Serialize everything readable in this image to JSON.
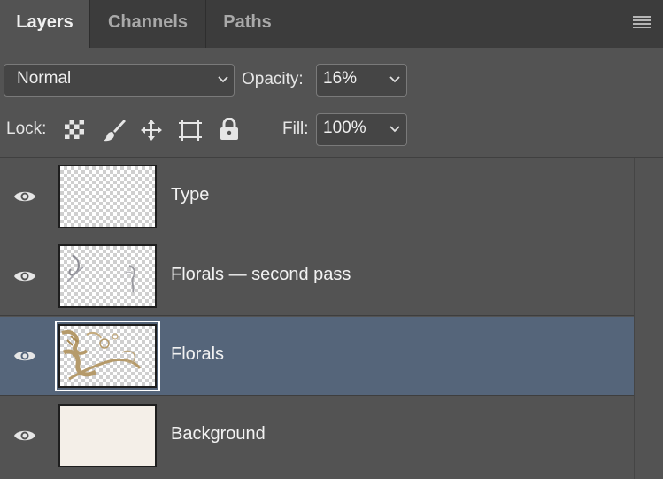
{
  "tabs": [
    {
      "label": "Layers",
      "active": true
    },
    {
      "label": "Channels",
      "active": false
    },
    {
      "label": "Paths",
      "active": false
    }
  ],
  "blend_mode": {
    "value": "Normal"
  },
  "opacity": {
    "label": "Opacity:",
    "value": "16%"
  },
  "lock": {
    "label": "Lock:",
    "icons": [
      "lock-transparent-pixels-icon",
      "lock-image-pixels-icon",
      "lock-position-icon",
      "lock-artboard-icon",
      "lock-all-icon"
    ]
  },
  "fill": {
    "label": "Fill:",
    "value": "100%"
  },
  "layers": [
    {
      "name": "Type",
      "visible": true,
      "selected": false
    },
    {
      "name": "Florals — second pass",
      "visible": true,
      "selected": false
    },
    {
      "name": "Florals",
      "visible": true,
      "selected": true
    },
    {
      "name": "Background",
      "visible": true,
      "selected": false
    }
  ],
  "colors": {
    "panel_bg": "#535353",
    "tabbar_bg": "#3c3c3c",
    "selected_row": "#55657a",
    "background_fill": "#f4efe8",
    "floral_gold": "#b59a6a"
  }
}
